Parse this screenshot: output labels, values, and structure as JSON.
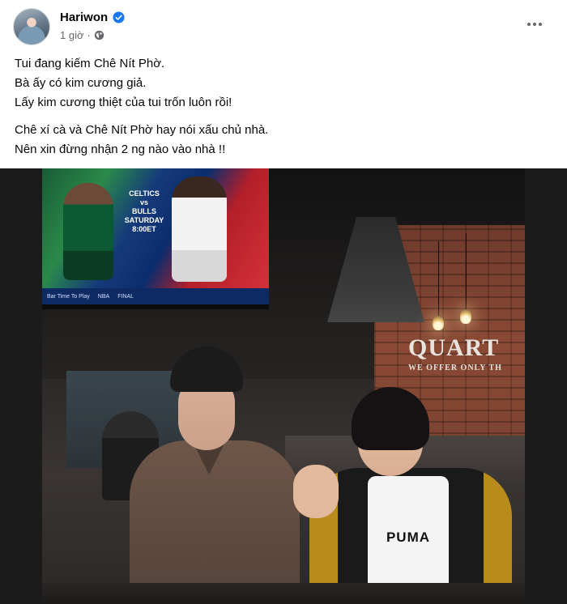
{
  "post": {
    "author": "Hariwon",
    "timestamp": "1 giờ",
    "separator": "·",
    "icons": {
      "verified": "verified-badge-icon",
      "audience": "globe-icon",
      "more": "more-horizontal-icon"
    },
    "colors": {
      "verified_blue": "#1877f2",
      "meta_gray": "#65676b",
      "text": "#050505"
    },
    "text_lines": [
      "Tui đang kiếm Chê Nít Phờ.",
      "Bà ấy có kim cương giả.",
      "Lấy kim cương thiệt của tui trốn luôn rồi!",
      "Chê xí cà và Chê Nít Phờ hay nói xấu chủ nhà.",
      "Nên xin đừng nhận 2 ng nào vào nhà !!"
    ]
  },
  "photo": {
    "tv_text": [
      "CELTICS",
      "vs",
      "BULLS",
      "SATURDAY",
      "8:00ET"
    ],
    "tv_ticker": [
      "Bar Time To Play",
      "NBA",
      "FINAL"
    ],
    "wall_sign": [
      "QUART",
      "WE OFFER ONLY TH"
    ],
    "shirt_logo": "PUMA"
  }
}
